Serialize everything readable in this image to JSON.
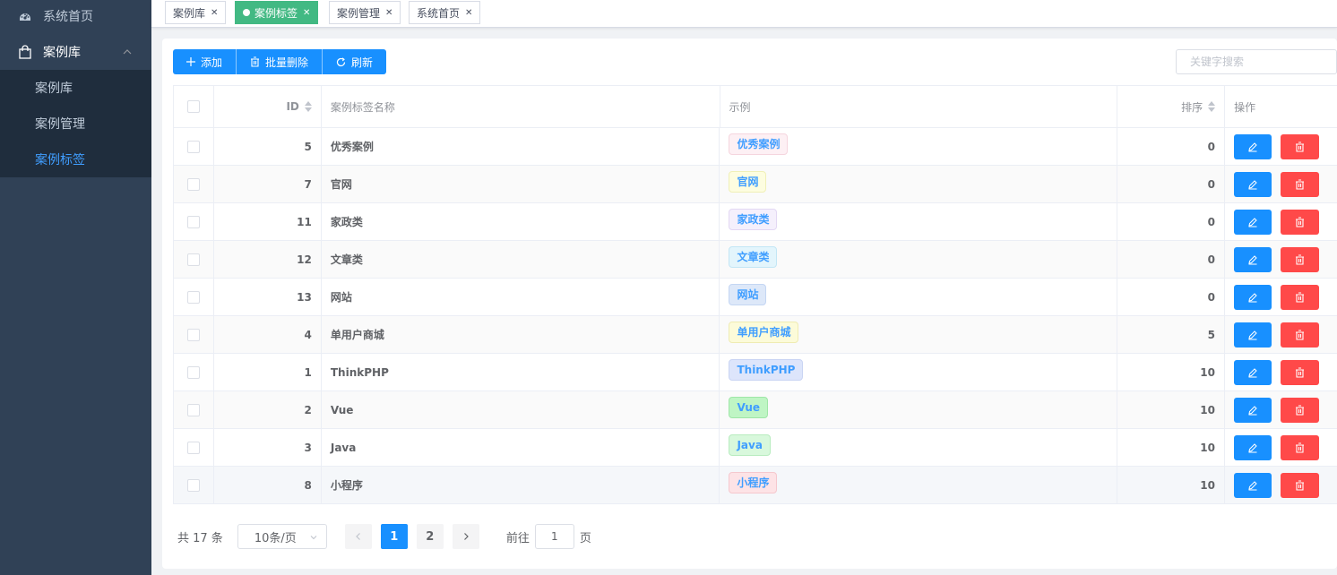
{
  "sidebar": {
    "home_label": "系统首页",
    "group_label": "案例库",
    "items": [
      {
        "label": "案例库"
      },
      {
        "label": "案例管理"
      },
      {
        "label": "案例标签",
        "active": true
      }
    ]
  },
  "tags": [
    {
      "label": "案例库",
      "active": false
    },
    {
      "label": "案例标签",
      "active": true
    },
    {
      "label": "案例管理",
      "active": false
    },
    {
      "label": "系统首页",
      "active": false
    }
  ],
  "toolbar": {
    "add_label": "添加",
    "batch_delete_label": "批量删除",
    "refresh_label": "刷新"
  },
  "search": {
    "placeholder": "关键字搜索",
    "value": ""
  },
  "table": {
    "headers": {
      "id": "ID",
      "name": "案例标签名称",
      "example": "示例",
      "sort": "排序",
      "ops": "操作"
    },
    "rows": [
      {
        "id": "5",
        "name": "优秀案例",
        "example": "优秀案例",
        "sort": "0",
        "tag_bg": "#fdf0f4",
        "tag_border": "#f5d5de"
      },
      {
        "id": "7",
        "name": "官网",
        "example": "官网",
        "sort": "0",
        "tag_bg": "#fdfde0",
        "tag_border": "#f0f0b8"
      },
      {
        "id": "11",
        "name": "家政类",
        "example": "家政类",
        "sort": "0",
        "tag_bg": "#f5f0fc",
        "tag_border": "#e3d8f3"
      },
      {
        "id": "12",
        "name": "文章类",
        "example": "文章类",
        "sort": "0",
        "tag_bg": "#e3f5fc",
        "tag_border": "#c3e6f5"
      },
      {
        "id": "13",
        "name": "网站",
        "example": "网站",
        "sort": "0",
        "tag_bg": "#dde8f9",
        "tag_border": "#c4d6f3"
      },
      {
        "id": "4",
        "name": "单用户商城",
        "example": "单用户商城",
        "sort": "5",
        "tag_bg": "#fcfbd9",
        "tag_border": "#efecb3"
      },
      {
        "id": "1",
        "name": "ThinkPHP",
        "example": "ThinkPHP",
        "sort": "10",
        "tag_bg": "#dde5fb",
        "tag_border": "#c9d4f3"
      },
      {
        "id": "2",
        "name": "Vue",
        "example": "Vue",
        "sort": "10",
        "tag_bg": "#bff5c4",
        "tag_border": "#9fe6a7"
      },
      {
        "id": "3",
        "name": "Java",
        "example": "Java",
        "sort": "10",
        "tag_bg": "#d8f8dc",
        "tag_border": "#b8ecbf"
      },
      {
        "id": "8",
        "name": "小程序",
        "example": "小程序",
        "sort": "10",
        "tag_bg": "#fde3e6",
        "tag_border": "#f5c8ce"
      }
    ]
  },
  "pagination": {
    "total_text": "共 17 条",
    "page_size": "10条/页",
    "pages": [
      "1",
      "2"
    ],
    "current_page": "1",
    "goto_prefix": "前往",
    "goto_value": "1",
    "goto_suffix": "页"
  },
  "colors": {
    "sidebar_bg": "#304156",
    "submenu_bg": "#1f2d3d",
    "primary": "#1890ff",
    "danger": "#ff4949",
    "active_tag": "#42b983"
  }
}
